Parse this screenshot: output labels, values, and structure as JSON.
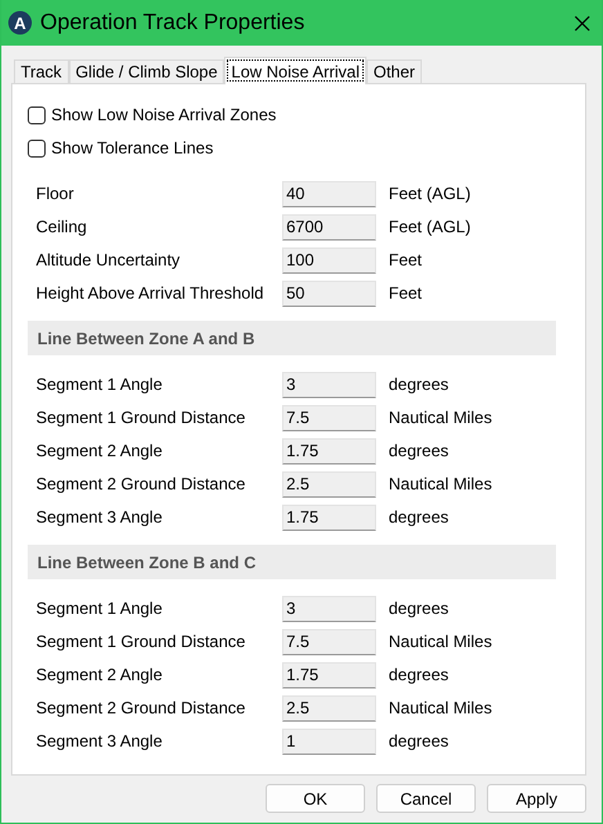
{
  "window": {
    "title": "Operation Track Properties",
    "app_letter": "A"
  },
  "tabs": [
    {
      "label": "Track",
      "selected": false
    },
    {
      "label": "Glide / Climb Slope",
      "selected": false
    },
    {
      "label": "Low Noise Arrival",
      "selected": true
    },
    {
      "label": "Other",
      "selected": false
    }
  ],
  "checkboxes": [
    {
      "label": "Show Low Noise Arrival Zones",
      "checked": false
    },
    {
      "label": "Show Tolerance Lines",
      "checked": false
    }
  ],
  "fields": [
    {
      "label": "Floor",
      "value": "40",
      "unit": "Feet (AGL)"
    },
    {
      "label": "Ceiling",
      "value": "6700",
      "unit": "Feet (AGL)"
    },
    {
      "label": "Altitude Uncertainty",
      "value": "100",
      "unit": "Feet"
    },
    {
      "label": "Height Above Arrival Threshold",
      "value": "50",
      "unit": "Feet"
    }
  ],
  "sections": [
    {
      "title": "Line Between Zone A and B",
      "fields": [
        {
          "label": "Segment 1 Angle",
          "value": "3",
          "unit": "degrees"
        },
        {
          "label": "Segment 1 Ground Distance",
          "value": "7.5",
          "unit": "Nautical Miles"
        },
        {
          "label": "Segment 2 Angle",
          "value": "1.75",
          "unit": "degrees"
        },
        {
          "label": "Segment 2 Ground Distance",
          "value": "2.5",
          "unit": "Nautical Miles"
        },
        {
          "label": "Segment 3 Angle",
          "value": "1.75",
          "unit": "degrees"
        }
      ]
    },
    {
      "title": "Line Between Zone B and C",
      "fields": [
        {
          "label": "Segment 1 Angle",
          "value": "3",
          "unit": "degrees"
        },
        {
          "label": "Segment 1 Ground Distance",
          "value": "7.5",
          "unit": "Nautical Miles"
        },
        {
          "label": "Segment 2 Angle",
          "value": "1.75",
          "unit": "degrees"
        },
        {
          "label": "Segment 2 Ground Distance",
          "value": "2.5",
          "unit": "Nautical Miles"
        },
        {
          "label": "Segment 3 Angle",
          "value": "1",
          "unit": "degrees"
        }
      ]
    }
  ],
  "buttons": [
    "OK",
    "Cancel",
    "Apply"
  ]
}
